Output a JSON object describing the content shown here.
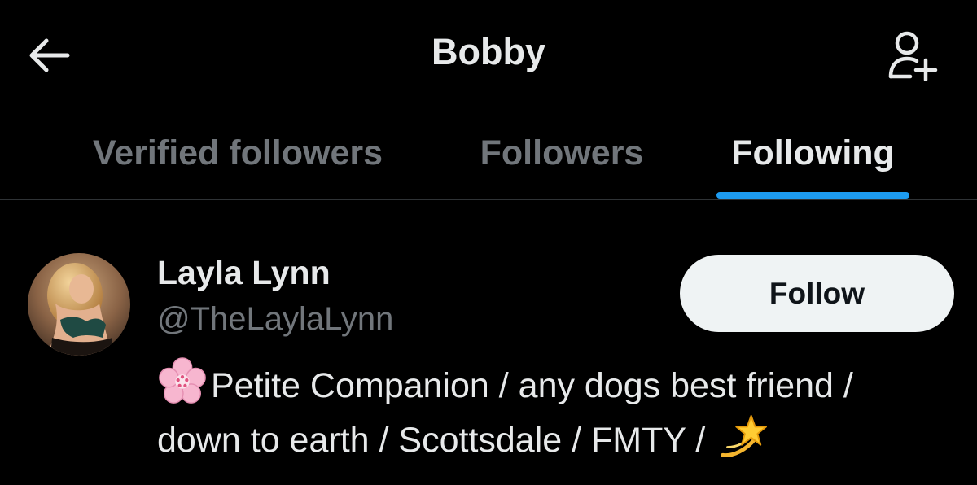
{
  "header": {
    "title": "Bobby",
    "back_icon": "arrow-left-icon",
    "add_user_icon": "person-plus-icon"
  },
  "tabs": [
    {
      "label": "Verified followers",
      "active": false
    },
    {
      "label": "Followers",
      "active": false
    },
    {
      "label": "Following",
      "active": true
    }
  ],
  "user": {
    "display_name": "Layla Lynn",
    "handle": "@TheLaylaLynn",
    "follow_label": "Follow",
    "bio_line1": "Petite Companion / any dogs best friend /",
    "bio_line2": "down to earth / Scottsdale / FMTY /",
    "bio_lead_icon": "cherry-blossom-icon",
    "bio_tail_icon": "dizzy-star-icon"
  },
  "colors": {
    "background": "#000000",
    "text_primary": "#e7e9ea",
    "text_secondary": "#71767b",
    "accent": "#1d9bf0",
    "divider": "#2f3336",
    "button_bg": "#eff3f4",
    "button_text": "#0f1419"
  }
}
